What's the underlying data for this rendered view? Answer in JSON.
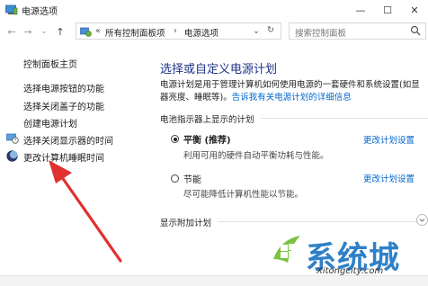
{
  "window": {
    "title": "电源选项",
    "minimize_glyph": "—",
    "maximize_glyph": "☐",
    "close_glyph": "✕"
  },
  "nav": {
    "back_glyph": "←",
    "forward_glyph": "→",
    "history_glyph": "⌄",
    "up_glyph": "↑"
  },
  "address": {
    "separator1": "«",
    "crumb1": "所有控制面板项",
    "separator2": "›",
    "crumb2": "电源选项",
    "dropdown_glyph": "⌄",
    "refresh_glyph": "↻"
  },
  "search": {
    "placeholder": "搜索控制面板"
  },
  "sidebar": {
    "home": "控制面板主页",
    "items": [
      "选择电源按钮的功能",
      "选择关闭盖子的功能",
      "创建电源计划",
      "选择关闭显示器的时间",
      "更改计算机睡眠时间"
    ]
  },
  "main": {
    "heading": "选择或自定义电源计划",
    "desc_line1": "电源计划是用于管理计算机如何使用电源的一套硬件和系统设置(如显",
    "desc_line2": "器亮度、睡眠等)。",
    "desc_link": "告诉我有关电源计划的详细信息",
    "section_label": "电池指示器上显示的计划",
    "plans": [
      {
        "name": "平衡 (推荐)",
        "desc": "利用可用的硬件自动平衡功耗与性能。",
        "link": "更改计划设置",
        "selected": true
      },
      {
        "name": "节能",
        "desc": "尽可能降低计算机性能以节能。",
        "link": "更改计划设置",
        "selected": false
      }
    ],
    "more_label": "显示附加计划"
  },
  "watermark": {
    "text": "系统城",
    "url": "Xitongcity.com"
  },
  "colors": {
    "link": "#0066cc",
    "heading": "#1e3287",
    "arrow": "#e03030",
    "watermark": "#2f80c8"
  }
}
